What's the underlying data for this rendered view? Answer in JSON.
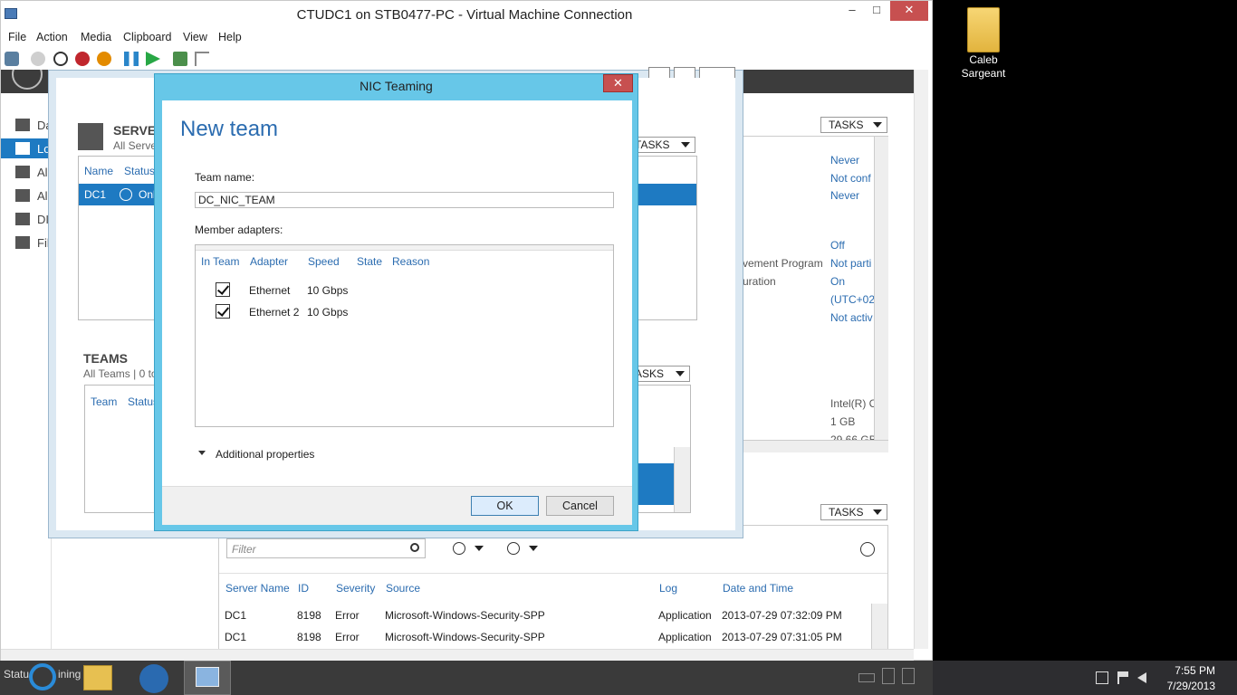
{
  "vm": {
    "title": "CTUDC1 on STB0477-PC - Virtual Machine Connection",
    "menu": [
      "File",
      "Action",
      "Media",
      "Clipboard",
      "View",
      "Help"
    ]
  },
  "guest": {
    "nav": [
      "Da",
      "Lo",
      "Al",
      "Al",
      "DI",
      "Fil"
    ],
    "tasks_label": "TASKS",
    "right_props": {
      "values": [
        "Never",
        "Not conf",
        "Never",
        "Off",
        "Not parti",
        "On",
        "(UTC+02",
        "Not activ",
        "Intel(R) C",
        "1 GB",
        "29.66 GB"
      ],
      "labels": [
        "vement Program",
        "uration"
      ]
    },
    "events": {
      "filter_placeholder": "Filter",
      "columns": [
        "Server Name",
        "ID",
        "Severity",
        "Source",
        "Log",
        "Date and Time"
      ],
      "rows": [
        [
          "DC1",
          "8198",
          "Error",
          "Microsoft-Windows-Security-SPP",
          "Application",
          "2013-07-29 07:32:09 PM"
        ],
        [
          "DC1",
          "8198",
          "Error",
          "Microsoft-Windows-Security-SPP",
          "Application",
          "2013-07-29 07:31:05 PM"
        ]
      ]
    },
    "status_fragment": "Statu",
    "status_fragment2": "ining"
  },
  "sm": {
    "servers_title": "SERVER",
    "servers_sub": "All Serve",
    "servers_columns": [
      "Name",
      "Status"
    ],
    "server_row": {
      "name": "DC1",
      "status": "Onl"
    },
    "teams_title": "TEAMS",
    "teams_sub": "All Teams | 0 to",
    "teams_columns": [
      "Team",
      "Status"
    ],
    "tasks_partial": "TASKS",
    "tasks_partial2": "ASKS"
  },
  "nic": {
    "title": "NIC Teaming",
    "close": "✕",
    "heading": "New team",
    "team_name_label": "Team name:",
    "team_name_value": "DC_NIC_TEAM",
    "member_label": "Member adapters:",
    "columns": [
      "In Team",
      "Adapter",
      "Speed",
      "State",
      "Reason"
    ],
    "adapters": [
      {
        "name": "Ethernet",
        "speed": "10 Gbps"
      },
      {
        "name": "Ethernet 2",
        "speed": "10 Gbps"
      }
    ],
    "additional": "Additional properties",
    "ok": "OK",
    "cancel": "Cancel"
  },
  "desktop": {
    "folder_label_line1": "Caleb",
    "folder_label_line2": "Sargeant"
  },
  "tray": {
    "time": "7:55 PM",
    "date": "7/29/2013"
  }
}
